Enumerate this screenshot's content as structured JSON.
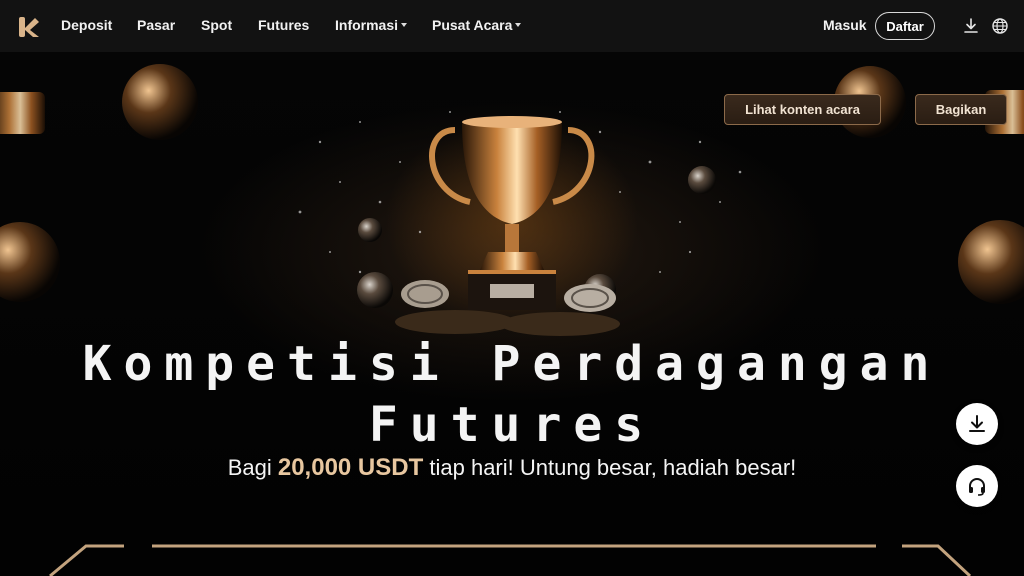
{
  "header": {
    "nav": [
      {
        "label": "Deposit",
        "dropdown": false
      },
      {
        "label": "Pasar",
        "dropdown": false
      },
      {
        "label": "Spot",
        "dropdown": false
      },
      {
        "label": "Futures",
        "dropdown": false
      },
      {
        "label": "Informasi",
        "dropdown": true
      },
      {
        "label": "Pusat Acara",
        "dropdown": true
      }
    ],
    "login_label": "Masuk",
    "register_label": "Daftar",
    "icons": [
      "download-icon",
      "globe-icon"
    ]
  },
  "hero": {
    "event_button": "Lihat konten acara",
    "share_button": "Bagikan",
    "title_line1": "Kompetisi Perdagangan",
    "title_line2": "Futures",
    "subtitle_before": "Bagi ",
    "subtitle_amount": "20,000 USDT",
    "subtitle_after": " tiap hari! Untung besar, hadiah besar!"
  },
  "floating": {
    "icons": [
      "download-icon",
      "headset-icon"
    ]
  },
  "colors": {
    "accent": "#e8c7a0",
    "button_border": "#8c6a4a",
    "header_bg": "#121212"
  }
}
